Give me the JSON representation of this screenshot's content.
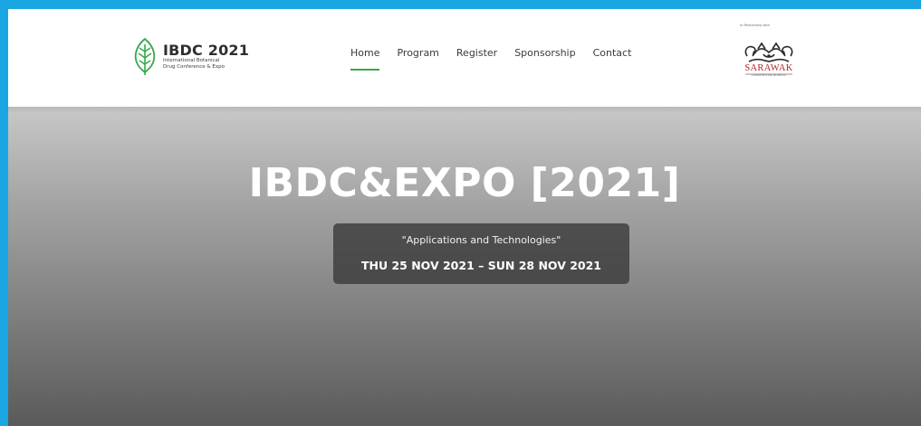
{
  "brand": {
    "title": "IBDC 2021",
    "subtitle_line1": "International Botanical",
    "subtitle_line2": "Drug Conference & Expo",
    "accent_color": "#36a84a"
  },
  "nav": {
    "items": [
      {
        "label": "Home",
        "active": true
      },
      {
        "label": "Program",
        "active": false
      },
      {
        "label": "Register",
        "active": false
      },
      {
        "label": "Sponsorship",
        "active": false
      },
      {
        "label": "Contact",
        "active": false
      }
    ]
  },
  "partner": {
    "label": "In Partnership with",
    "name": "SARAWAK",
    "sub": "CONVENTION BUREAU",
    "name_color": "#b0272a"
  },
  "hero": {
    "title": "IBDC&EXPO [2021]",
    "tagline": "\"Applications and Technologies\"",
    "dates": "THU 25 NOV 2021 – SUN 28 NOV 2021"
  },
  "colors": {
    "frame_border": "#1aa6e3",
    "hero_top": "#c8c8c8",
    "hero_bottom": "#5a5a5a"
  }
}
